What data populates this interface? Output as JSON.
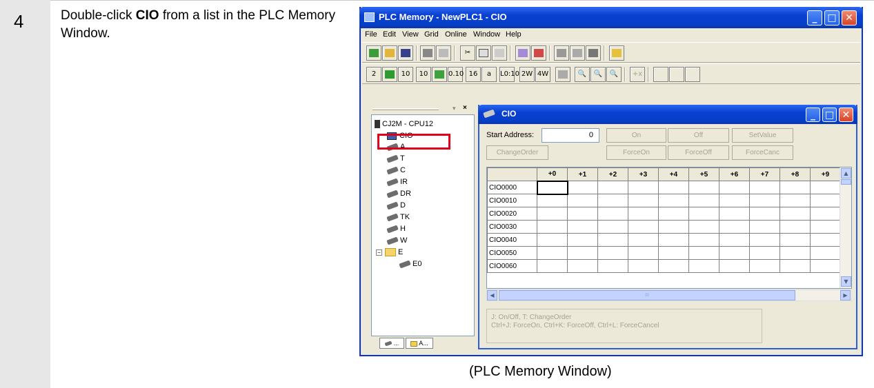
{
  "step": {
    "number": "4",
    "text_before": "Double-click ",
    "text_bold": "CIO",
    "text_after": " from a list in the PLC Memory Window."
  },
  "caption": "(PLC Memory Window)",
  "window": {
    "title": "PLC Memory - NewPLC1 - CIO",
    "menu": [
      "File",
      "Edit",
      "View",
      "Grid",
      "Online",
      "Window",
      "Help"
    ],
    "toolbar2_labels": [
      "2",
      "",
      "10",
      "10",
      "0.10",
      "16",
      "a",
      "L0:10",
      "2W",
      "4W",
      "",
      "",
      "",
      "",
      "+x",
      "",
      "",
      ""
    ]
  },
  "tree": {
    "root": "CJ2M - CPU12",
    "items": [
      "CIO",
      "A",
      "T",
      "C",
      "IR",
      "DR",
      "D",
      "TK",
      "H",
      "W"
    ],
    "folder": "E",
    "folder_child": "E0",
    "tabs": [
      "...",
      "A..."
    ]
  },
  "child": {
    "title": "CIO",
    "start_address_label": "Start Address:",
    "start_address_value": "0",
    "buttons_row1": [
      "On",
      "Off",
      "SetValue"
    ],
    "buttons_row2": [
      "ChangeOrder",
      "ForceOn",
      "ForceOff",
      "ForceCanc"
    ],
    "columns": [
      "+0",
      "+1",
      "+2",
      "+3",
      "+4",
      "+5",
      "+6",
      "+7",
      "+8",
      "+9"
    ],
    "rows": [
      "CIO0000",
      "CIO0010",
      "CIO0020",
      "CIO0030",
      "CIO0040",
      "CIO0050",
      "CIO0060"
    ],
    "hint_line1": "J: On/Off,   T: ChangeOrder",
    "hint_line2": "Ctrl+J: ForceOn,   Ctrl+K: ForceOff,   Ctrl+L: ForceCancel",
    "hscroll_mark": "III"
  }
}
